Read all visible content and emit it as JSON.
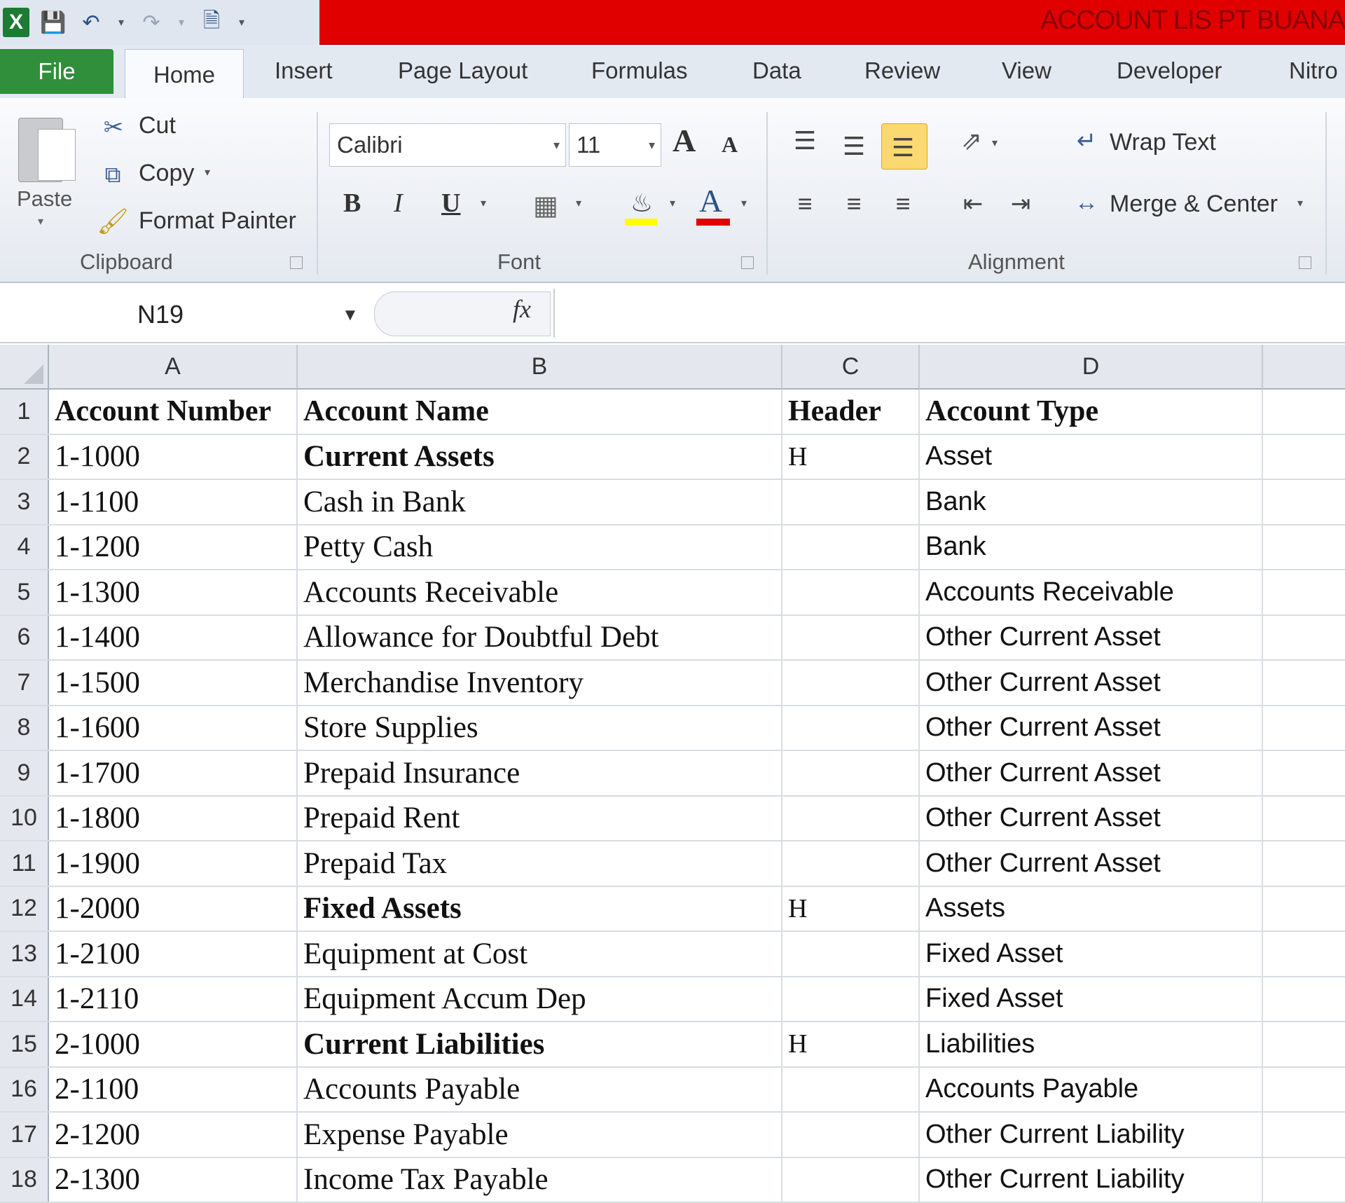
{
  "title_bar": {
    "title": "ACCOUNT LIS PT BUANA"
  },
  "tabs": [
    "File",
    "Home",
    "Insert",
    "Page Layout",
    "Formulas",
    "Data",
    "Review",
    "View",
    "Developer",
    "Nitro"
  ],
  "clipboard": {
    "paste": "Paste",
    "cut": "Cut",
    "copy": "Copy",
    "format_painter": "Format Painter",
    "group": "Clipboard"
  },
  "font": {
    "name": "Calibri",
    "size": "11",
    "bold": "B",
    "italic": "I",
    "underline": "U",
    "font_color": "A",
    "grow": "A",
    "shrink": "A",
    "group": "Font"
  },
  "alignment": {
    "wrap_text": "Wrap Text",
    "merge_center": "Merge & Center",
    "group": "Alignment"
  },
  "formula_bar": {
    "name_box": "N19",
    "fx": "fx",
    "formula": ""
  },
  "columns": [
    "A",
    "B",
    "C",
    "D"
  ],
  "rows": [
    {
      "n": "1",
      "a": "Account Number",
      "b": "Account Name",
      "c": "Header",
      "d": "Account Type"
    },
    {
      "n": "2",
      "a": "1-1000",
      "b": "Current Assets",
      "c": "H",
      "d": "Asset"
    },
    {
      "n": "3",
      "a": "1-1100",
      "b": "Cash in Bank",
      "c": "",
      "d": "Bank"
    },
    {
      "n": "4",
      "a": "1-1200",
      "b": "Petty Cash",
      "c": "",
      "d": "Bank"
    },
    {
      "n": "5",
      "a": "1-1300",
      "b": "Accounts Receivable",
      "c": "",
      "d": "Accounts Receivable"
    },
    {
      "n": "6",
      "a": "1-1400",
      "b": "Allowance for Doubtful Debt",
      "c": "",
      "d": "Other Current Asset"
    },
    {
      "n": "7",
      "a": "1-1500",
      "b": "Merchandise Inventory",
      "c": "",
      "d": "Other Current Asset"
    },
    {
      "n": "8",
      "a": "1-1600",
      "b": "Store Supplies",
      "c": "",
      "d": "Other Current Asset"
    },
    {
      "n": "9",
      "a": "1-1700",
      "b": "Prepaid Insurance",
      "c": "",
      "d": "Other Current Asset"
    },
    {
      "n": "10",
      "a": "1-1800",
      "b": "Prepaid Rent",
      "c": "",
      "d": "Other Current Asset"
    },
    {
      "n": "11",
      "a": "1-1900",
      "b": "Prepaid Tax",
      "c": "",
      "d": "Other Current Asset"
    },
    {
      "n": "12",
      "a": "1-2000",
      "b": "Fixed Assets",
      "c": "H",
      "d": "Assets"
    },
    {
      "n": "13",
      "a": "1-2100",
      "b": "Equipment at Cost",
      "c": "",
      "d": "Fixed Asset"
    },
    {
      "n": "14",
      "a": "1-2110",
      "b": "Equipment Accum Dep",
      "c": "",
      "d": "Fixed Asset"
    },
    {
      "n": "15",
      "a": "2-1000",
      "b": "Current Liabilities",
      "c": "H",
      "d": "Liabilities"
    },
    {
      "n": "16",
      "a": "2-1100",
      "b": "Accounts Payable",
      "c": "",
      "d": "Accounts Payable"
    },
    {
      "n": "17",
      "a": "2-1200",
      "b": "Expense Payable",
      "c": "",
      "d": "Other Current Liability"
    },
    {
      "n": "18",
      "a": "2-1300",
      "b": "Income Tax Payable",
      "c": "",
      "d": "Other Current Liability"
    }
  ]
}
